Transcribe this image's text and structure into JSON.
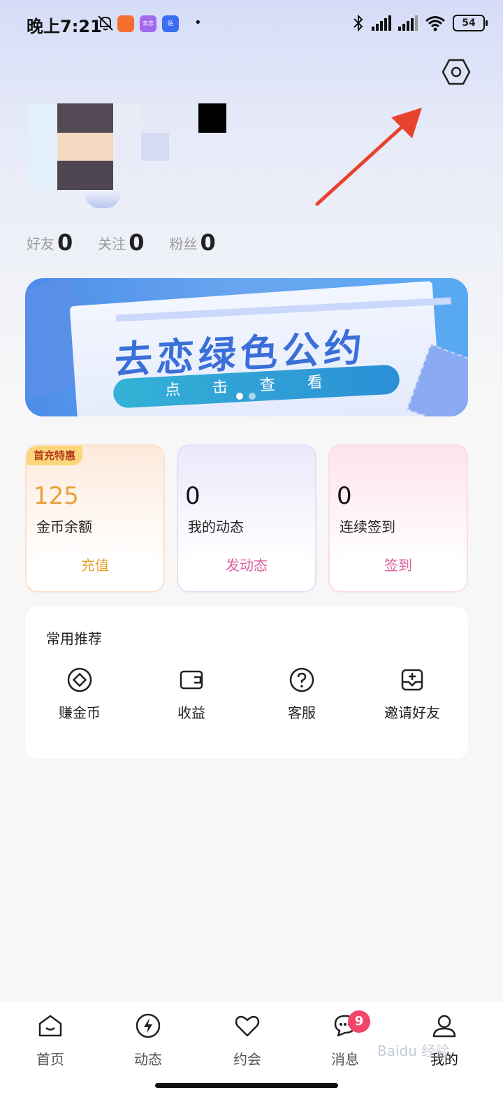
{
  "status_bar": {
    "time": "晚上7:21",
    "battery": "54",
    "app_icons": [
      {
        "name": "taobao-app-icon",
        "color": "#f46f2f",
        "label": ""
      },
      {
        "name": "qulian-app-icon",
        "color": "#a368f0",
        "label": "去恋"
      },
      {
        "name": "tieba-app-icon",
        "color": "#3b6df2",
        "label": "贴"
      }
    ]
  },
  "profile": {
    "stats": [
      {
        "label": "好友",
        "value": "0"
      },
      {
        "label": "关注",
        "value": "0"
      },
      {
        "label": "粉丝",
        "value": "0"
      }
    ]
  },
  "banner": {
    "title": "去恋绿色公约",
    "cta": "点击查看 >",
    "page_count": 2,
    "active_page": 1
  },
  "cards": [
    {
      "badge": "首充特惠",
      "value": "125",
      "label": "金币余额",
      "button": "充值"
    },
    {
      "value": "0",
      "label": "我的动态",
      "button": "发动态"
    },
    {
      "value": "0",
      "label": "连续签到",
      "button": "签到"
    }
  ],
  "recommend": {
    "title": "常用推荐",
    "items": [
      {
        "label": "赚金币",
        "icon": "coin-icon"
      },
      {
        "label": "收益",
        "icon": "wallet-icon"
      },
      {
        "label": "客服",
        "icon": "help-icon"
      },
      {
        "label": "邀请好友",
        "icon": "invite-icon"
      }
    ]
  },
  "bottom_nav": {
    "items": [
      {
        "label": "首页",
        "icon": "home-icon"
      },
      {
        "label": "动态",
        "icon": "flash-icon"
      },
      {
        "label": "约会",
        "icon": "heart-icon"
      },
      {
        "label": "消息",
        "icon": "message-icon",
        "badge": "9"
      },
      {
        "label": "我的",
        "icon": "profile-icon",
        "active": true
      }
    ]
  },
  "watermark": "Baidu 经验"
}
